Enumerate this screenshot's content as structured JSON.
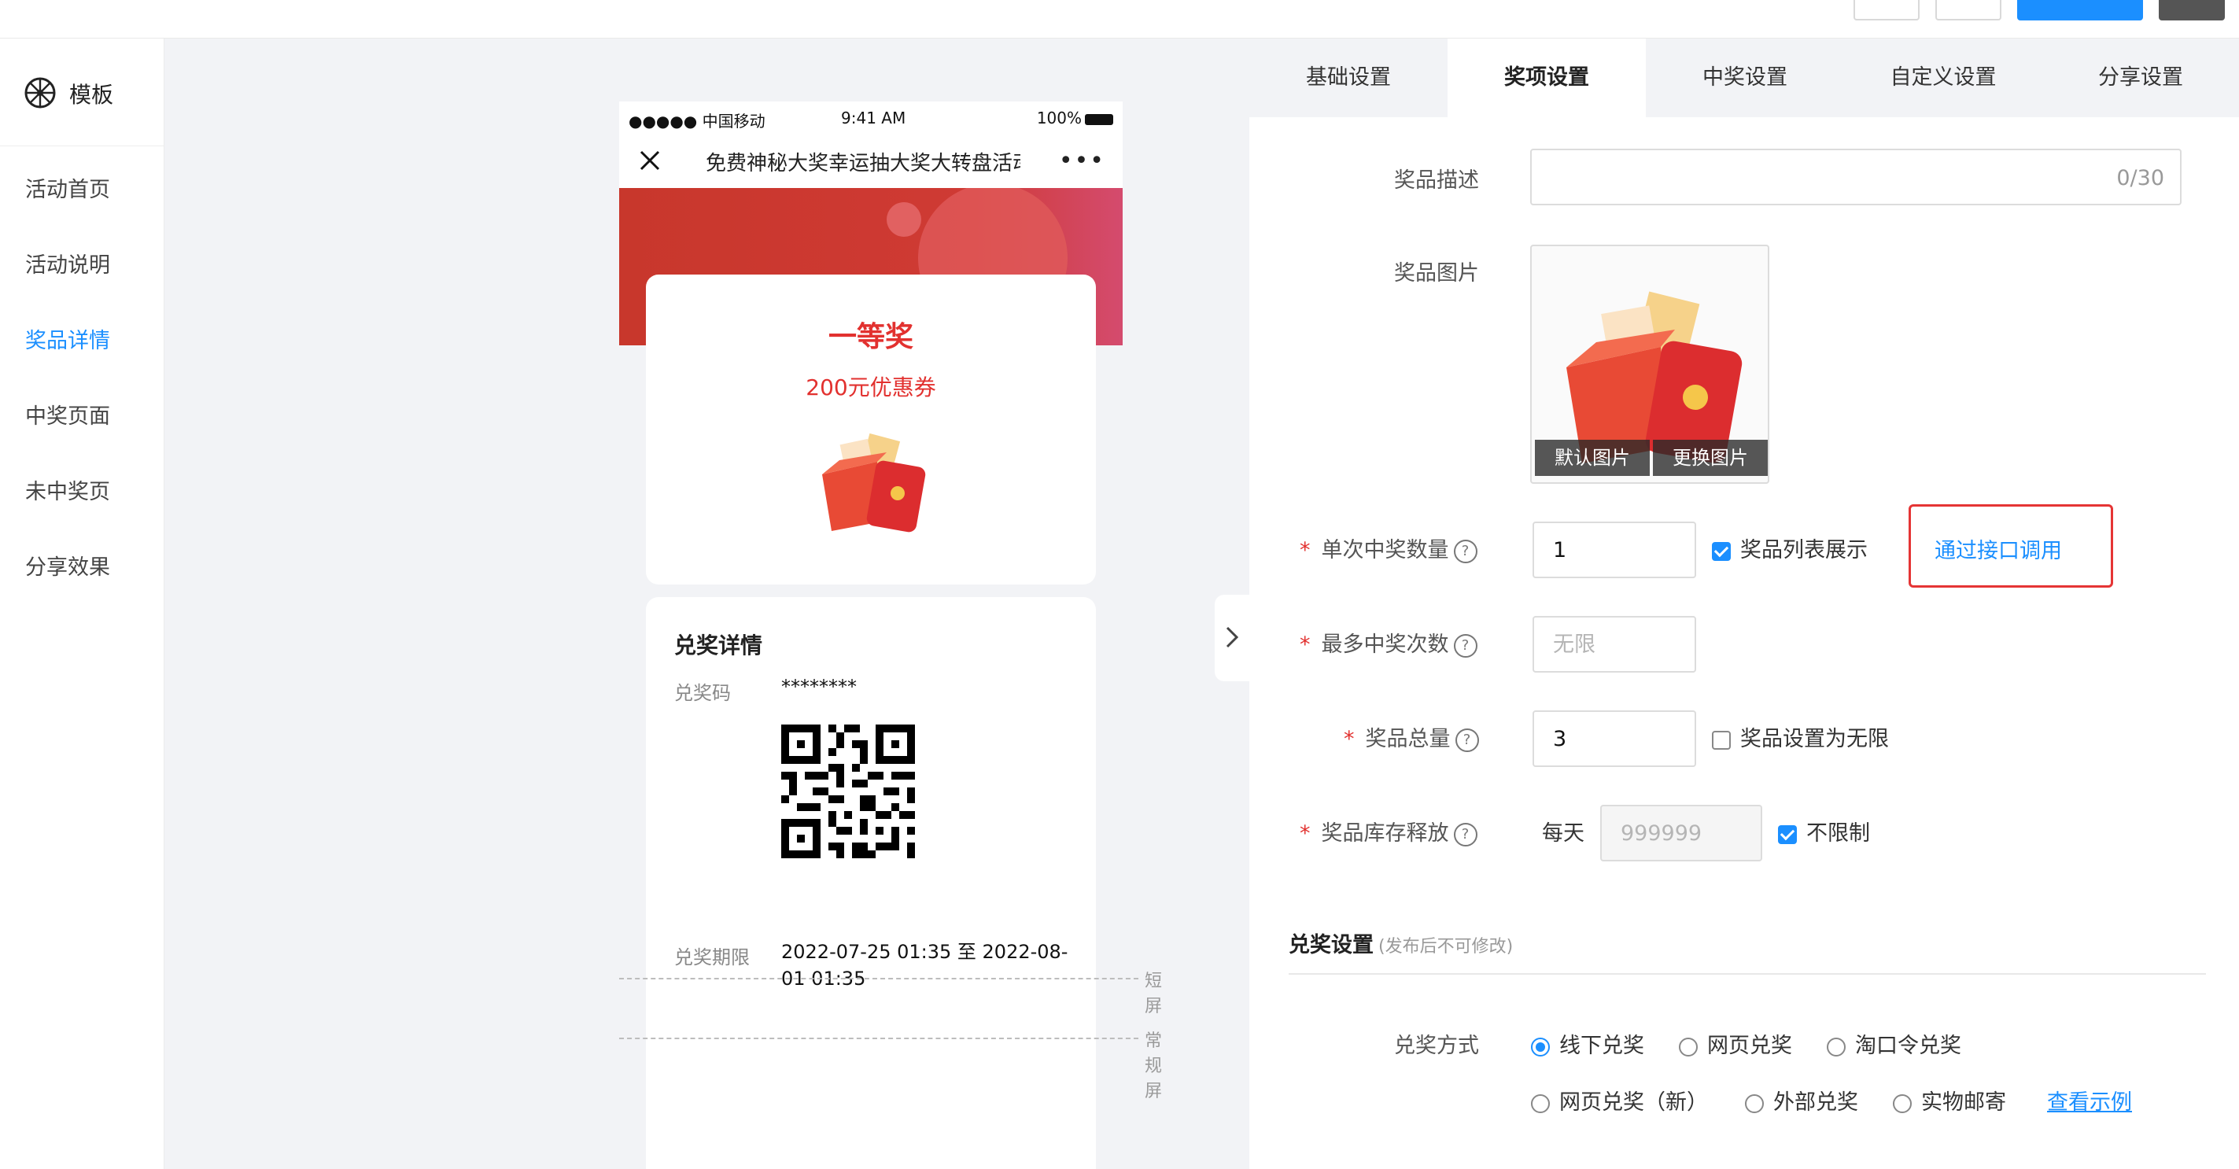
{
  "nav": {
    "title": "模板",
    "items": [
      "活动首页",
      "活动说明",
      "奖品详情",
      "中奖页面",
      "未中奖页",
      "分享效果"
    ],
    "active_index": 2
  },
  "phone": {
    "carrier": "●●●●● 中国移动",
    "time": "9:41 AM",
    "battery": "100%",
    "title": "免费神秘大奖幸运抽大奖大转盘活动",
    "prize_level": "一等奖",
    "prize_value": "200元优惠券",
    "detail_title": "兑奖详情",
    "code_label": "兑奖码",
    "code_value": "********",
    "period_label": "兑奖期限",
    "period_value": "2022-07-25 01:35 至 2022-08-01 01:35",
    "guide_short": "短屏",
    "guide_normal": "常规屏"
  },
  "tabs": [
    "基础设置",
    "奖项设置",
    "中奖设置",
    "自定义设置",
    "分享设置"
  ],
  "active_tab": 1,
  "form": {
    "desc_label": "奖品描述",
    "desc_count": "0/30",
    "image_label": "奖品图片",
    "default_image_btn": "默认图片",
    "change_image_btn": "更换图片",
    "per_win_label": "单次中奖数量",
    "per_win_value": "1",
    "show_in_list_label": "奖品列表展示",
    "show_in_list_checked": true,
    "api_link": "通过接口调用",
    "max_win_label": "最多中奖次数",
    "max_win_placeholder": "无限",
    "total_label": "奖品总量",
    "total_value": "3",
    "unlimited_label": "奖品设置为无限",
    "unlimited_checked": false,
    "release_label": "奖品库存释放",
    "release_prefix": "每天",
    "release_placeholder": "999999",
    "no_limit_label": "不限制",
    "no_limit_checked": true
  },
  "redeem": {
    "section_title": "兑奖设置",
    "section_sub": "(发布后不可修改)",
    "method_label": "兑奖方式",
    "options": [
      "线下兑奖",
      "网页兑奖",
      "淘口令兑奖",
      "网页兑奖（新）",
      "外部兑奖",
      "实物邮寄"
    ],
    "selected_index": 0,
    "example_link": "查看示例"
  },
  "colors": {
    "accent": "#1b8fff",
    "prize_red": "#e2312f",
    "highlight_border": "#e53535"
  }
}
